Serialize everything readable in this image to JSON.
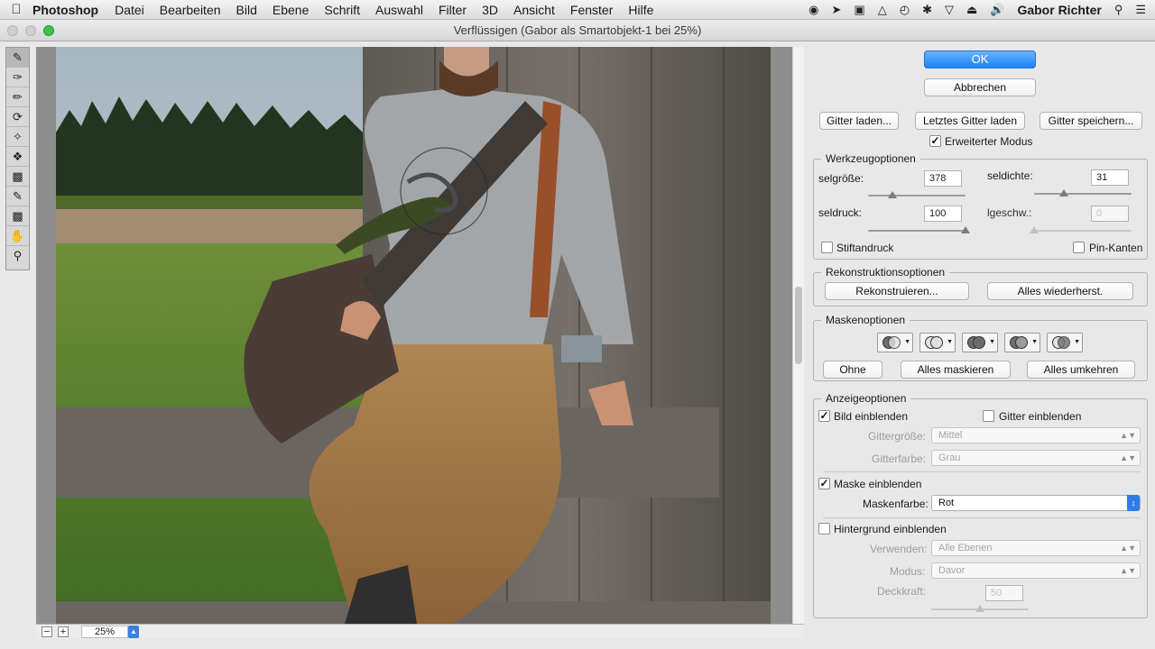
{
  "menubar": {
    "app": "Photoshop",
    "items": [
      "Datei",
      "Bearbeiten",
      "Bild",
      "Ebene",
      "Schrift",
      "Auswahl",
      "Filter",
      "3D",
      "Ansicht",
      "Fenster",
      "Hilfe"
    ],
    "user": "Gabor Richter",
    "status_icons": [
      "creative-cloud-icon",
      "forward-icon",
      "display-icon",
      "airplay-icon",
      "time-machine-icon",
      "bluetooth-icon",
      "wifi-icon",
      "eject-icon",
      "volume-icon",
      "search-icon",
      "list-icon"
    ]
  },
  "window": {
    "title": "Verflüssigen (Gabor als Smartobjekt-1 bei 25%)"
  },
  "tools": [
    "warp-tool-icon",
    "reconstruct-tool-icon",
    "smooth-tool-icon",
    "twirl-tool-icon",
    "pucker-tool-icon",
    "bloat-tool-icon",
    "push-left-tool-icon",
    "freeze-mask-tool-icon",
    "thaw-mask-tool-icon",
    "hand-tool-icon",
    "zoom-tool-icon"
  ],
  "status": {
    "zoom": "25%",
    "minus": "−",
    "plus": "+"
  },
  "panel": {
    "ok": "OK",
    "cancel": "Abbrechen",
    "mesh_load": "Gitter laden...",
    "mesh_last": "Letztes Gitter laden",
    "mesh_save": "Gitter speichern...",
    "advanced_mode": "Erweiterter Modus",
    "advanced_mode_checked": true,
    "tool_options": {
      "legend": "Werkzeugoptionen",
      "size_label": "selgröße:",
      "size_value": "378",
      "size_level": 0.25,
      "density_label": "seldichte:",
      "density_value": "31",
      "density_level": 0.31,
      "pressure_label": "seldruck:",
      "pressure_value": "100",
      "pressure_level": 1.0,
      "rate_label": "lgeschw.:",
      "rate_value": "0",
      "rate_level": 0.0,
      "stylus_label": "Stiftandruck",
      "pin_edges_label": "Pin-Kanten"
    },
    "reconstruct_options": {
      "legend": "Rekonstruktionsoptionen",
      "reconstruct": "Rekonstruieren...",
      "restore_all": "Alles wiederherst."
    },
    "mask_options": {
      "legend": "Maskenoptionen",
      "modes": [
        "replace-selection-icon",
        "add-to-selection-icon",
        "subtract-from-selection-icon",
        "intersect-selection-icon",
        "invert-selection-icon"
      ],
      "none": "Ohne",
      "mask_all": "Alles maskieren",
      "invert_all": "Alles umkehren"
    },
    "view_options": {
      "legend": "Anzeigeoptionen",
      "show_image": "Bild einblenden",
      "show_image_checked": true,
      "show_mesh": "Gitter einblenden",
      "show_mesh_checked": false,
      "mesh_size_label": "Gittergröße:",
      "mesh_size": "Mittel",
      "mesh_color_label": "Gitterfarbe:",
      "mesh_color": "Grau",
      "show_mask": "Maske einblenden",
      "show_mask_checked": true,
      "mask_color_label": "Maskenfarbe:",
      "mask_color": "Rot",
      "show_backdrop": "Hintergrund einblenden",
      "show_backdrop_checked": false,
      "use_label": "Verwenden:",
      "use_value": "Alle Ebenen",
      "mode_label": "Modus:",
      "mode_value": "Davor",
      "opacity_label": "Deckkraft:",
      "opacity_value": "50",
      "opacity_level": 0.5
    }
  },
  "colors": {
    "accent": "#1a82fb",
    "traffic_green": "#3fc04a"
  }
}
